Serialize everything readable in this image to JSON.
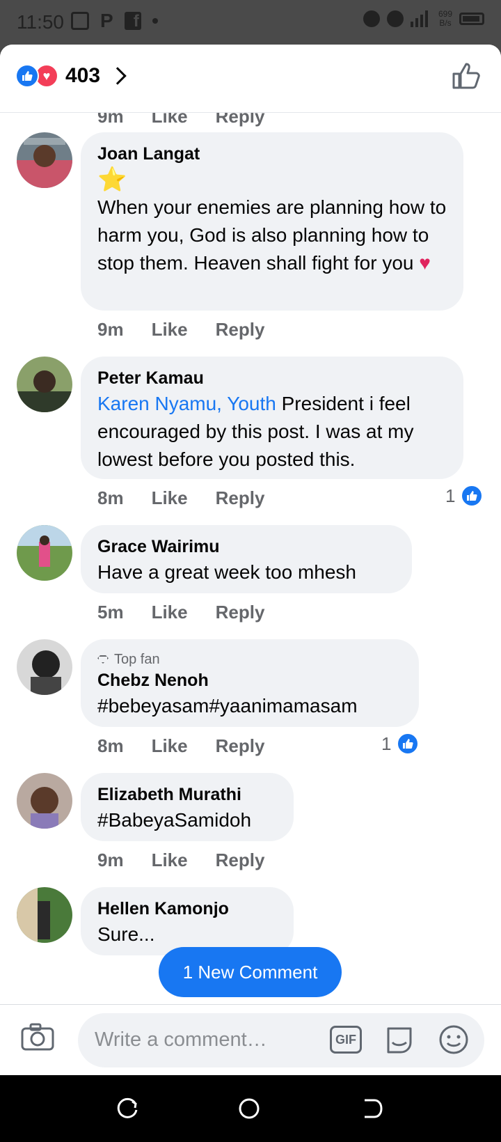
{
  "status_bar": {
    "time": "11:50",
    "network": "4G",
    "speed": "699",
    "speed_unit": "B/s"
  },
  "header": {
    "reaction_count": "403"
  },
  "cutoff_meta": [
    "9m",
    "Like",
    "Reply"
  ],
  "comments": [
    {
      "name": "Joan Langat",
      "star": "⭐",
      "text": "When your enemies are planning how to harm you, God is also planning how to stop them. Heaven shall fight for you",
      "heart": "♥",
      "time": "9m",
      "like": "Like",
      "reply": "Reply"
    },
    {
      "name": "Peter Kamau",
      "mention": "Karen Nyamu, Youth",
      "text": " President i feel encouraged by this post. I was at my lowest before you posted this.",
      "time": "8m",
      "like": "Like",
      "reply": "Reply",
      "likes": "1"
    },
    {
      "name": "Grace Wairimu",
      "text": "Have a great week too mhesh",
      "time": "5m",
      "like": "Like",
      "reply": "Reply"
    },
    {
      "badge": "Top fan",
      "name": "Chebz Nenoh",
      "text": "#bebeyasam#yaanimamasam",
      "time": "8m",
      "like": "Like",
      "reply": "Reply",
      "likes": "1"
    },
    {
      "name": "Elizabeth Murathi",
      "text": "#BabeyaSamidoh",
      "time": "9m",
      "like": "Like",
      "reply": "Reply"
    },
    {
      "name": "Hellen Kamonjo",
      "text": "Sure..."
    }
  ],
  "new_comment_button": "1 New Comment",
  "composer": {
    "placeholder": "Write a comment…",
    "gif_label": "GIF"
  }
}
